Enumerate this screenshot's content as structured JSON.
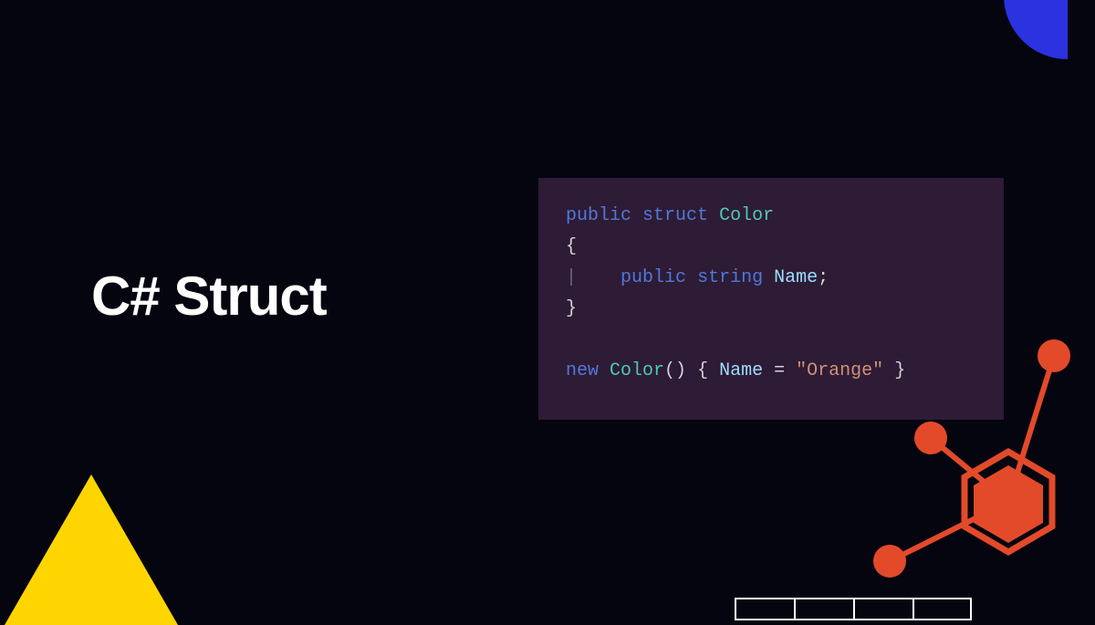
{
  "title": "C# Struct",
  "code": {
    "line1": {
      "kw1": "public",
      "kw2": "struct",
      "type": "Color"
    },
    "line2": "{",
    "line3": {
      "kw1": "public",
      "kw2": "string",
      "field": "Name",
      "end": ";"
    },
    "line4": "}",
    "line5": {
      "kw": "new",
      "type": "Color",
      "parens": "()",
      "brace1": "{",
      "field": "Name",
      "eq": "=",
      "str": "\"Orange\"",
      "brace2": "}"
    }
  }
}
